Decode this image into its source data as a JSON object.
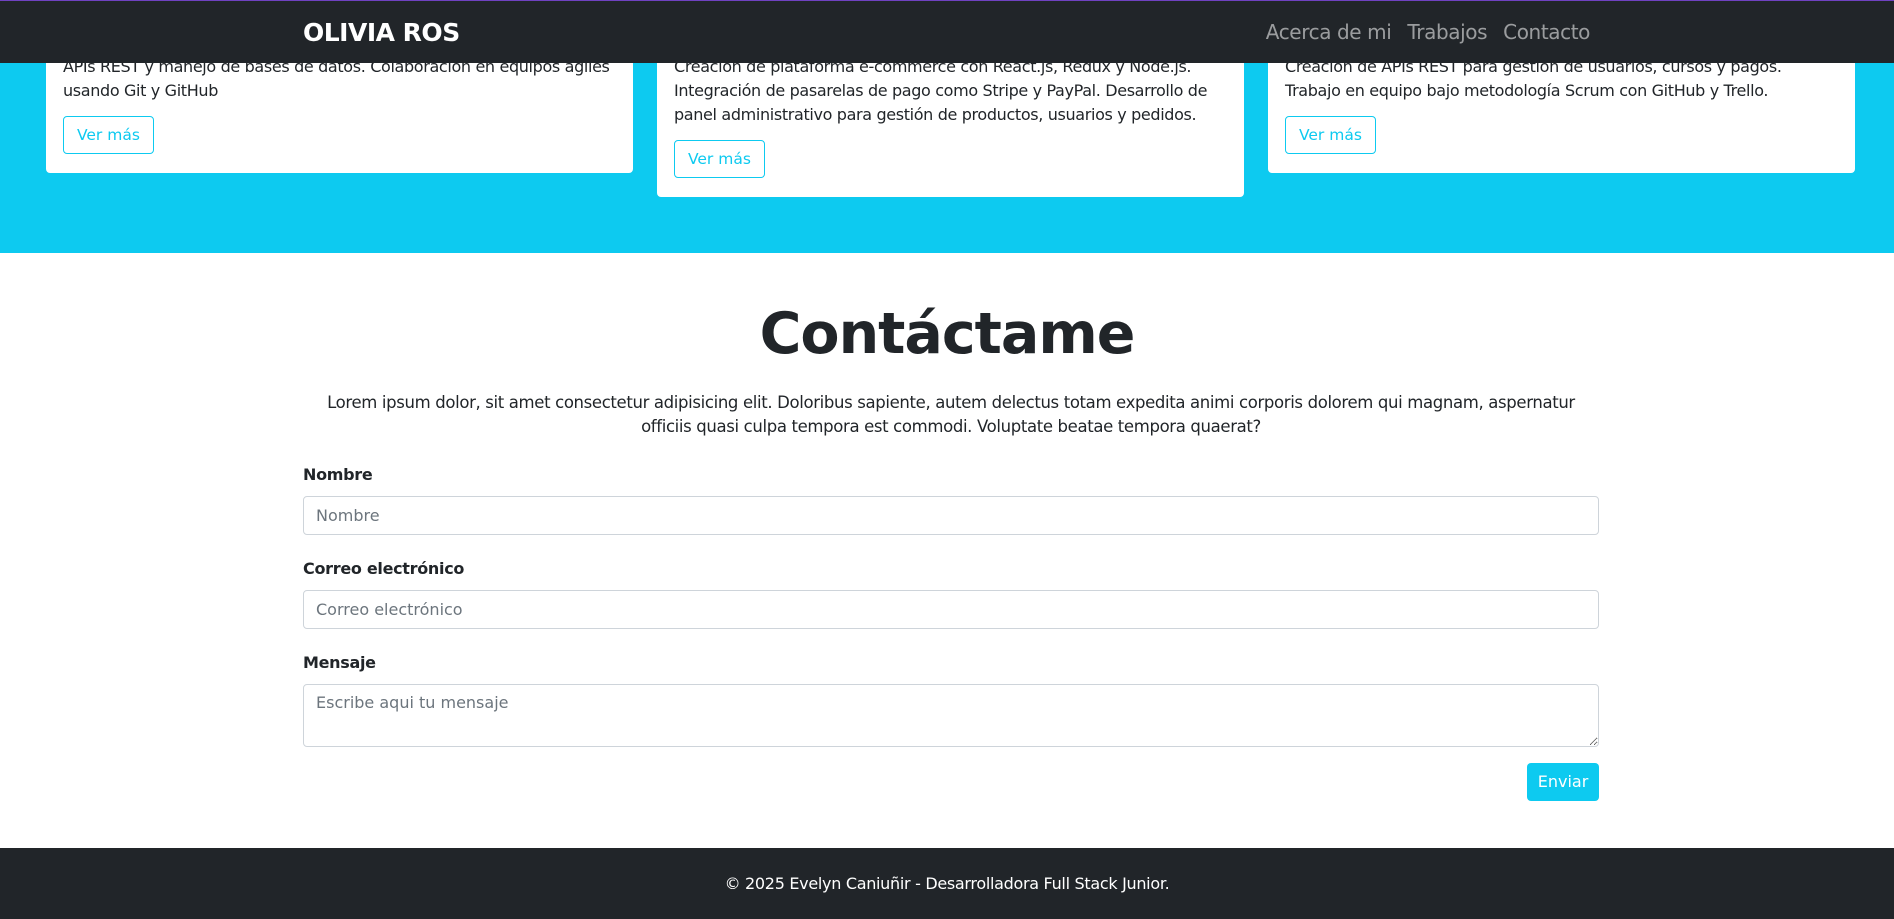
{
  "navbar": {
    "brand": "OLIVIA ROS",
    "links": [
      "Acerca de mi",
      "Trabajos",
      "Contacto"
    ]
  },
  "jobs": {
    "cards": [
      {
        "text": "APIs REST y manejo de bases de datos. Colaboración en equipos ágiles usando Git y GitHub",
        "button": "Ver más"
      },
      {
        "text": "Creación de plataforma e-commerce con React.js, Redux y Node.js. Integración de pasarelas de pago como Stripe y PayPal. Desarrollo de panel administrativo para gestión de productos, usuarios y pedidos.",
        "button": "Ver más"
      },
      {
        "text": "Creación de APIs REST para gestión de usuarios, cursos y pagos. Trabajo en equipo bajo metodología Scrum con GitHub y Trello.",
        "button": "Ver más"
      }
    ]
  },
  "contact": {
    "title": "Contáctame",
    "intro": "Lorem ipsum dolor, sit amet consectetur adipisicing elit. Doloribus sapiente, autem delectus totam expedita animi corporis dolorem qui magnam, aspernatur officiis quasi culpa tempora est commodi. Voluptate beatae tempora quaerat?",
    "name_label": "Nombre",
    "name_placeholder": "Nombre",
    "name_value": "",
    "email_label": "Correo electrónico",
    "email_placeholder": "Correo electrónico",
    "email_value": "",
    "message_label": "Mensaje",
    "message_placeholder": "Escribe aqui tu mensaje",
    "message_value": "",
    "submit": "Enviar"
  },
  "footer": {
    "text": "© 2025 Evelyn Caniuñir - Desarrolladora Full Stack Junior."
  },
  "colors": {
    "accent": "#0dcaf0",
    "dark": "#212529",
    "navbar_border": "#6f42c1"
  }
}
